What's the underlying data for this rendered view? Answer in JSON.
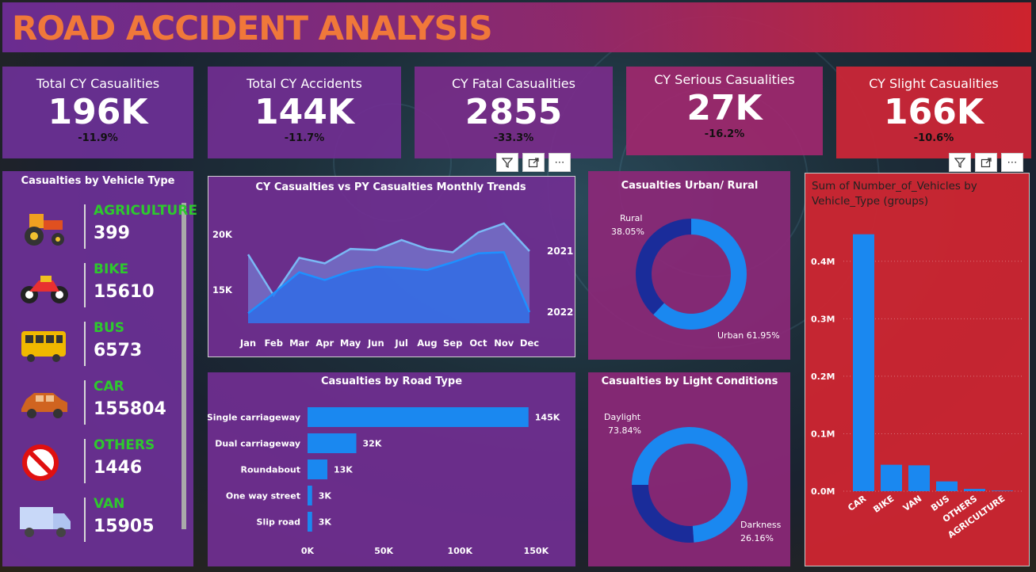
{
  "title": "ROAD ACCIDENT ANALYSIS",
  "kpis": [
    {
      "label": "Total CY Casualities",
      "value": "196K",
      "change": "-11.9%"
    },
    {
      "label": "Total CY Accidents",
      "value": "144K",
      "change": "-11.7%"
    },
    {
      "label": "CY Fatal Casualities",
      "value": "2855",
      "change": "-33.3%"
    },
    {
      "label": "CY Serious Casualities",
      "value": "27K",
      "change": "-16.2%"
    },
    {
      "label": "CY Slight Casualities",
      "value": "166K",
      "change": "-10.6%"
    }
  ],
  "vehicle_panel": {
    "title": "Casualties by Vehicle Type",
    "items": [
      {
        "name": "AGRICULTURE",
        "value": "399",
        "icon": "tractor-icon"
      },
      {
        "name": "BIKE",
        "value": "15610",
        "icon": "motorbike-icon"
      },
      {
        "name": "BUS",
        "value": "6573",
        "icon": "bus-icon"
      },
      {
        "name": "CAR",
        "value": "155804",
        "icon": "car-icon"
      },
      {
        "name": "OTHERS",
        "value": "1446",
        "icon": "prohibited-icon"
      },
      {
        "name": "VAN",
        "value": "15905",
        "icon": "van-icon"
      }
    ]
  },
  "toolbar": {
    "filter_icon": "filter-icon",
    "focus_icon": "focus-mode-icon",
    "more": "⋯"
  },
  "chart_data": [
    {
      "type": "area",
      "title": "CY Casualties vs PY Casualties Monthly Trends",
      "categories": [
        "Jan",
        "Feb",
        "Mar",
        "Apr",
        "May",
        "Jun",
        "Jul",
        "Aug",
        "Sep",
        "Oct",
        "Nov",
        "Dec"
      ],
      "series": [
        {
          "name": "2021",
          "values": [
            18200,
            14500,
            17900,
            17400,
            18700,
            18600,
            19500,
            18700,
            18400,
            20200,
            21000,
            18500
          ]
        },
        {
          "name": "2022",
          "values": [
            12900,
            14700,
            16600,
            15900,
            16700,
            17100,
            17000,
            16800,
            17500,
            18300,
            18400,
            13000
          ]
        }
      ],
      "yticks": [
        "15K",
        "20K"
      ],
      "ylim": [
        12000,
        22000
      ]
    },
    {
      "type": "pie",
      "title": "Casualties Urban/ Rural",
      "labels": [
        "Rural",
        "Urban"
      ],
      "values": [
        38.05,
        61.95
      ],
      "value_labels": [
        "38.05%",
        "61.95%"
      ],
      "colors": [
        "#1a2c9a",
        "#1a88f0"
      ]
    },
    {
      "type": "bar",
      "title": "Casualties by Road Type",
      "categories": [
        "Single carriageway",
        "Dual carriageway",
        "Roundabout",
        "One way street",
        "Slip road"
      ],
      "values": [
        145000,
        32000,
        13000,
        3000,
        3000
      ],
      "value_labels": [
        "145K",
        "32K",
        "13K",
        "3K",
        "3K"
      ],
      "xticks": [
        "0K",
        "50K",
        "100K",
        "150K"
      ],
      "xlim": [
        0,
        155000
      ]
    },
    {
      "type": "pie",
      "title": "Casualties by Light Conditions",
      "labels": [
        "Daylight",
        "Darkness"
      ],
      "values": [
        73.84,
        26.16
      ],
      "value_labels": [
        "73.84%",
        "26.16%"
      ],
      "colors": [
        "#1a88f0",
        "#1a2c9a"
      ]
    },
    {
      "type": "bar",
      "title": "Sum of Number_of_Vehicles by Vehicle_Type (groups)",
      "categories": [
        "CAR",
        "BIKE",
        "VAN",
        "BUS",
        "OTHERS",
        "AGRICULTURE"
      ],
      "values": [
        447000,
        46000,
        45000,
        17000,
        4000,
        1000
      ],
      "yticks": [
        "0.0M",
        "0.1M",
        "0.2M",
        "0.3M",
        "0.4M"
      ],
      "ylim": [
        0,
        470000
      ]
    }
  ]
}
